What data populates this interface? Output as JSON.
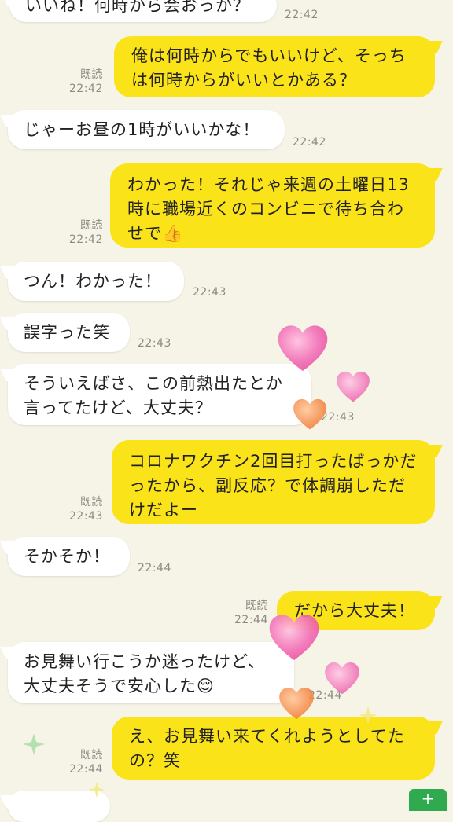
{
  "messages": [
    {
      "side": "in",
      "text": "いいね！何時から会おっか？",
      "time": "22:42"
    },
    {
      "side": "out",
      "text": "俺は何時からでもいいけど、そっちは何時からがいいとかある？",
      "time": "22:42",
      "read": "既読"
    },
    {
      "side": "in",
      "text": "じゃーお昼の1時がいいかな！",
      "time": "22:42"
    },
    {
      "side": "out",
      "text": "わかった！それじゃ来週の土曜日13時に職場近くのコンビニで待ち合わせで",
      "emoji": "👍",
      "time": "22:42",
      "read": "既読"
    },
    {
      "side": "in",
      "text": "つん！わかった！",
      "time": "22:43"
    },
    {
      "side": "in",
      "text": "誤字った笑",
      "time": "22:43"
    },
    {
      "side": "in",
      "text": "そういえばさ、この前熱出たとか言ってたけど、大丈夫？",
      "time": "22:43"
    },
    {
      "side": "out",
      "text": "コロナワクチン2回目打ったばっかだったから、副反応？で体調崩しただけだよー",
      "time": "22:43",
      "read": "既読"
    },
    {
      "side": "in",
      "text": "そかそか！",
      "time": "22:44"
    },
    {
      "side": "out",
      "text": "だから大丈夫！",
      "time": "22:44",
      "read": "既読"
    },
    {
      "side": "in",
      "text": "お見舞い行こうか迷ったけど、大丈夫そうで安心した",
      "emoji": "😌",
      "time": "22:44"
    },
    {
      "side": "out",
      "text": "え、お見舞い来てくれようとしてたの？笑",
      "time": "22:44",
      "read": "既読"
    }
  ],
  "send_button_label": "+",
  "colors": {
    "background": "#f6f4e6",
    "outgoing_bubble": "#fbe31a",
    "incoming_bubble": "#ffffff",
    "heart_pink": "#f06bb0",
    "heart_orange": "#f08a40",
    "send_button": "#2faa4f"
  },
  "icons": [
    "heart-icon",
    "sparkle-icon",
    "thumbs-up-emoji",
    "relieved-face-emoji"
  ]
}
